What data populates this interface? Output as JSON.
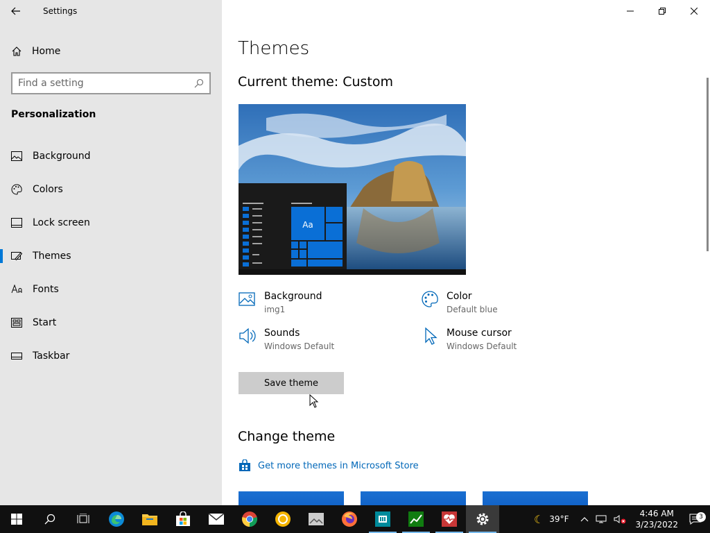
{
  "window": {
    "app_title": "Settings"
  },
  "sidebar": {
    "home_label": "Home",
    "search_placeholder": "Find a setting",
    "section_title": "Personalization",
    "items": [
      {
        "label": "Background",
        "icon": "picture-icon"
      },
      {
        "label": "Colors",
        "icon": "palette-icon"
      },
      {
        "label": "Lock screen",
        "icon": "lock-screen-icon"
      },
      {
        "label": "Themes",
        "icon": "themes-icon",
        "active": true
      },
      {
        "label": "Fonts",
        "icon": "fonts-icon"
      },
      {
        "label": "Start",
        "icon": "start-icon"
      },
      {
        "label": "Taskbar",
        "icon": "taskbar-icon"
      }
    ]
  },
  "main": {
    "page_title": "Themes",
    "current_theme": "Current theme: Custom",
    "preview_text": "Aa",
    "properties": {
      "background": {
        "name": "Background",
        "value": "img1"
      },
      "color": {
        "name": "Color",
        "value": "Default blue"
      },
      "sounds": {
        "name": "Sounds",
        "value": "Windows Default"
      },
      "mouse_cursor": {
        "name": "Mouse cursor",
        "value": "Windows Default"
      }
    },
    "save_button": "Save theme",
    "change_theme_title": "Change theme",
    "store_link": "Get more themes in Microsoft Store"
  },
  "taskbar": {
    "weather": "39°F",
    "time": "4:46 AM",
    "date": "3/23/2022",
    "notification_count": "3"
  },
  "colors": {
    "accent": "#0078d7",
    "link": "#0067b8",
    "sidebar_bg": "#e6e6e6",
    "taskbar_bg": "#101010"
  }
}
